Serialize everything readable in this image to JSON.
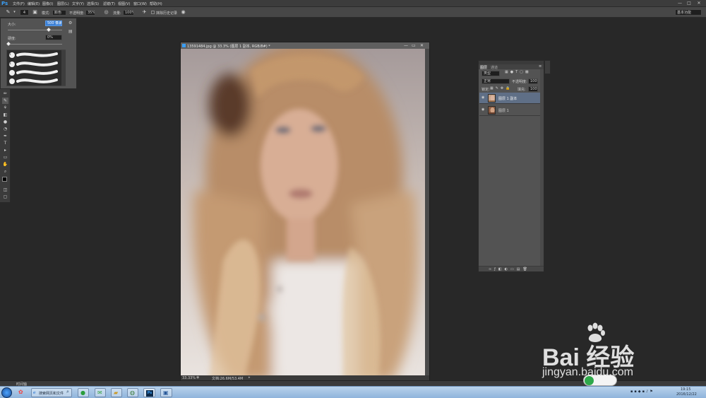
{
  "app": {
    "logo": "Ps"
  },
  "menubar": {
    "items": [
      "文件(F)",
      "编辑(E)",
      "图像(I)",
      "图层(L)",
      "文字(Y)",
      "选择(S)",
      "滤镜(T)",
      "视图(V)",
      "窗口(W)",
      "帮助(H)"
    ],
    "window_controls": [
      "—",
      "□",
      "✕"
    ]
  },
  "options": {
    "brush_size_badge": "4",
    "mode_label": "模式:",
    "mode_value": "颜色",
    "opacity_label": "不透明度:",
    "opacity_value": "35%",
    "flow_label": "流量:",
    "flow_value": "100%",
    "history_label": "抹除历史记录",
    "workspace": "基本功能"
  },
  "brush_popup": {
    "size_label": "大小:",
    "size_value": "500 像素",
    "hardness_label": "硬度:",
    "hardness_value": "0%",
    "presets_values": [
      "1",
      "3"
    ]
  },
  "document": {
    "title": "13591484.jpg @ 33.3% (图层 1 副本, RGB/8#) *",
    "zoom": "33.33%",
    "doc_info": "文档:26.6M/53.4M"
  },
  "layers_panel": {
    "tabs": [
      "图层",
      "通道"
    ],
    "filter_label": "类型",
    "blend_mode": "正常",
    "opacity_label": "不透明度:",
    "opacity_value": "100%",
    "lock_label": "锁定:",
    "fill_label": "填充:",
    "fill_value": "100%",
    "layers": [
      {
        "name": "图层 1 副本",
        "selected": true
      },
      {
        "name": "图层 1",
        "selected": false
      }
    ]
  },
  "bottom": {
    "timeline_label": "时间轴"
  },
  "taskbar": {
    "search_text": "搜索网页和文件",
    "clock_time": "19:15",
    "clock_date": "2016/12/22"
  },
  "watermark": {
    "brand": "Bai 经验",
    "url": "jingyan.baidu.com"
  },
  "colors": {
    "accent": "#3a9ef5",
    "selected_layer": "#5f6f86",
    "panel": "#535353",
    "workspace": "#282828"
  }
}
